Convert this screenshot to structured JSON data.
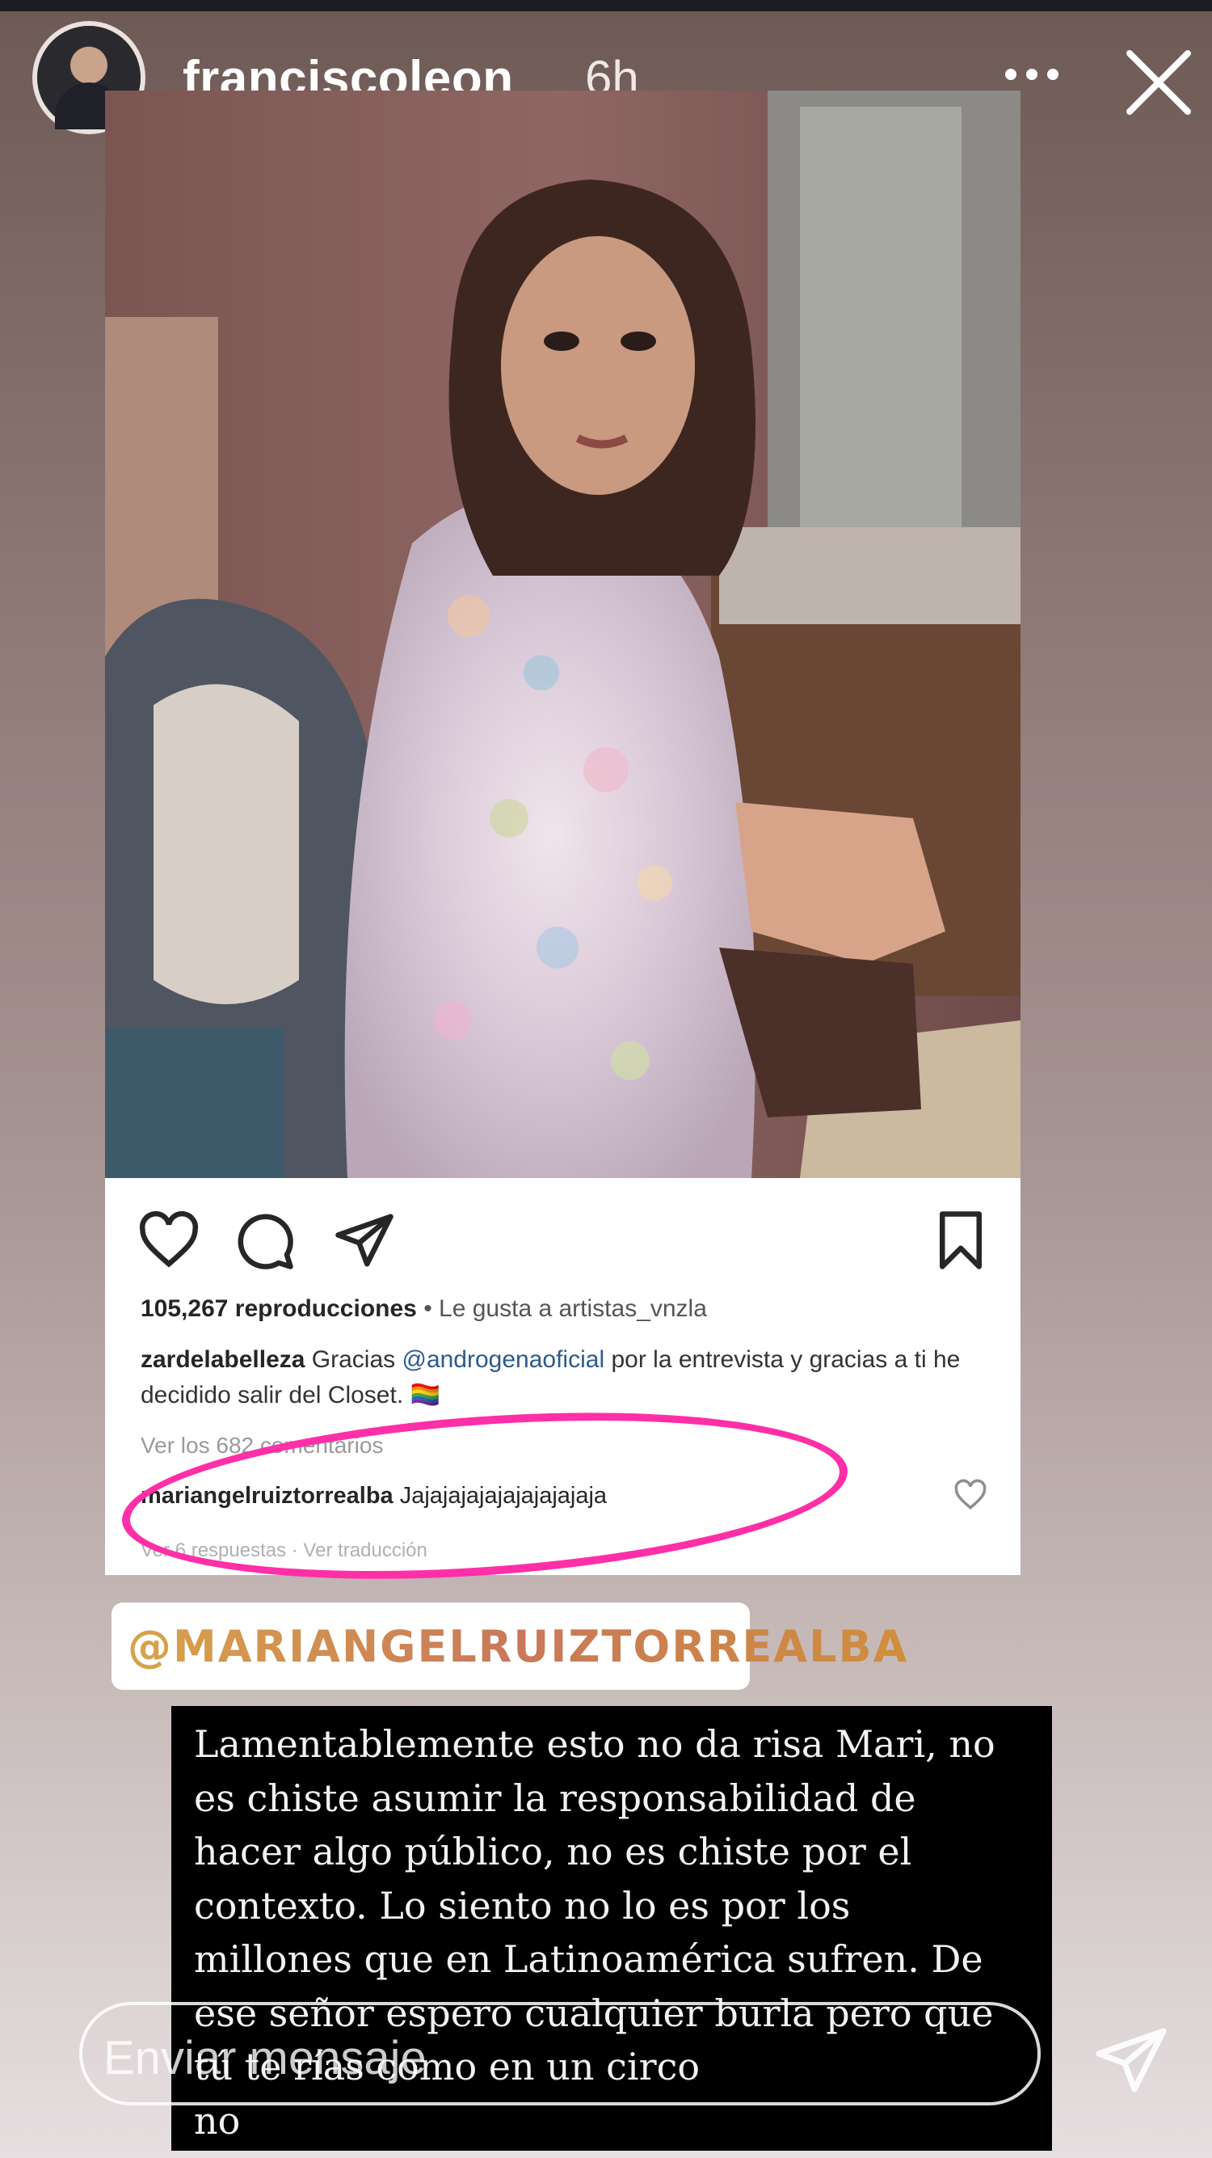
{
  "story": {
    "username": "franciscoleon",
    "time": "6h"
  },
  "post": {
    "views": "105,267 reproducciones",
    "separator": "•",
    "liked_by": "Le gusta a artistas_vnzla",
    "caption_user": "zardelabelleza",
    "caption_text_1": "Gracias",
    "caption_mention": "@androgenaoficial",
    "caption_text_2": "por la entrevista y gracias a ti he decidido salir del Closet.",
    "caption_emoji": "🏳️‍🌈",
    "view_comments": "Ver los 682 comentarios",
    "comment_user": "mariangelruiztorrealba",
    "comment_text": "Jajajajajajajajajajaja",
    "hidden_replies": "Ver 6 respuestas · Ver traducción"
  },
  "mention_sticker": "@MARIANGELRUIZTORREALBA",
  "textbox_lines": [
    "Lamentablemente esto no da risa Mari, no",
    "es chiste asumir la responsabilidad de",
    "hacer algo público, no es chiste por el",
    "contexto. Lo siento no lo es por los",
    "millones que en Latinoamérica sufren. De",
    "ese señor espero cualquier burla pero que",
    "tú te rías como en un circo",
    "no"
  ],
  "reply": {
    "placeholder": "Enviar mensaje"
  },
  "colors": {
    "annotation_circle": "#ff2fa8",
    "textbox_bg": "#000000"
  }
}
